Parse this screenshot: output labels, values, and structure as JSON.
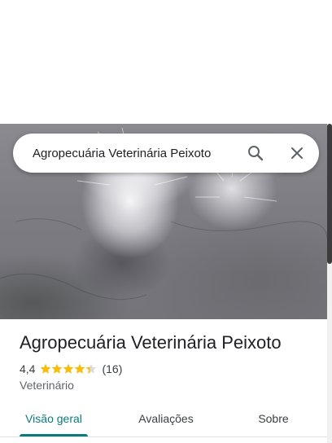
{
  "search": {
    "value": "Agropecuária Veterinária Peixoto",
    "search_icon": "search-icon",
    "close_icon": "close-icon"
  },
  "place": {
    "name": "Agropecuária Veterinária Peixoto",
    "rating": "4,4",
    "rating_value": 4.4,
    "rating_max": 5,
    "review_count": "(16)",
    "category": "Veterinário"
  },
  "tabs": [
    {
      "label": "Visão geral",
      "active": true
    },
    {
      "label": "Avaliações",
      "active": false
    },
    {
      "label": "Sobre",
      "active": false
    }
  ],
  "colors": {
    "accent": "#0b7a7a",
    "star": "#fbbc04",
    "star_empty": "#dadce0"
  }
}
